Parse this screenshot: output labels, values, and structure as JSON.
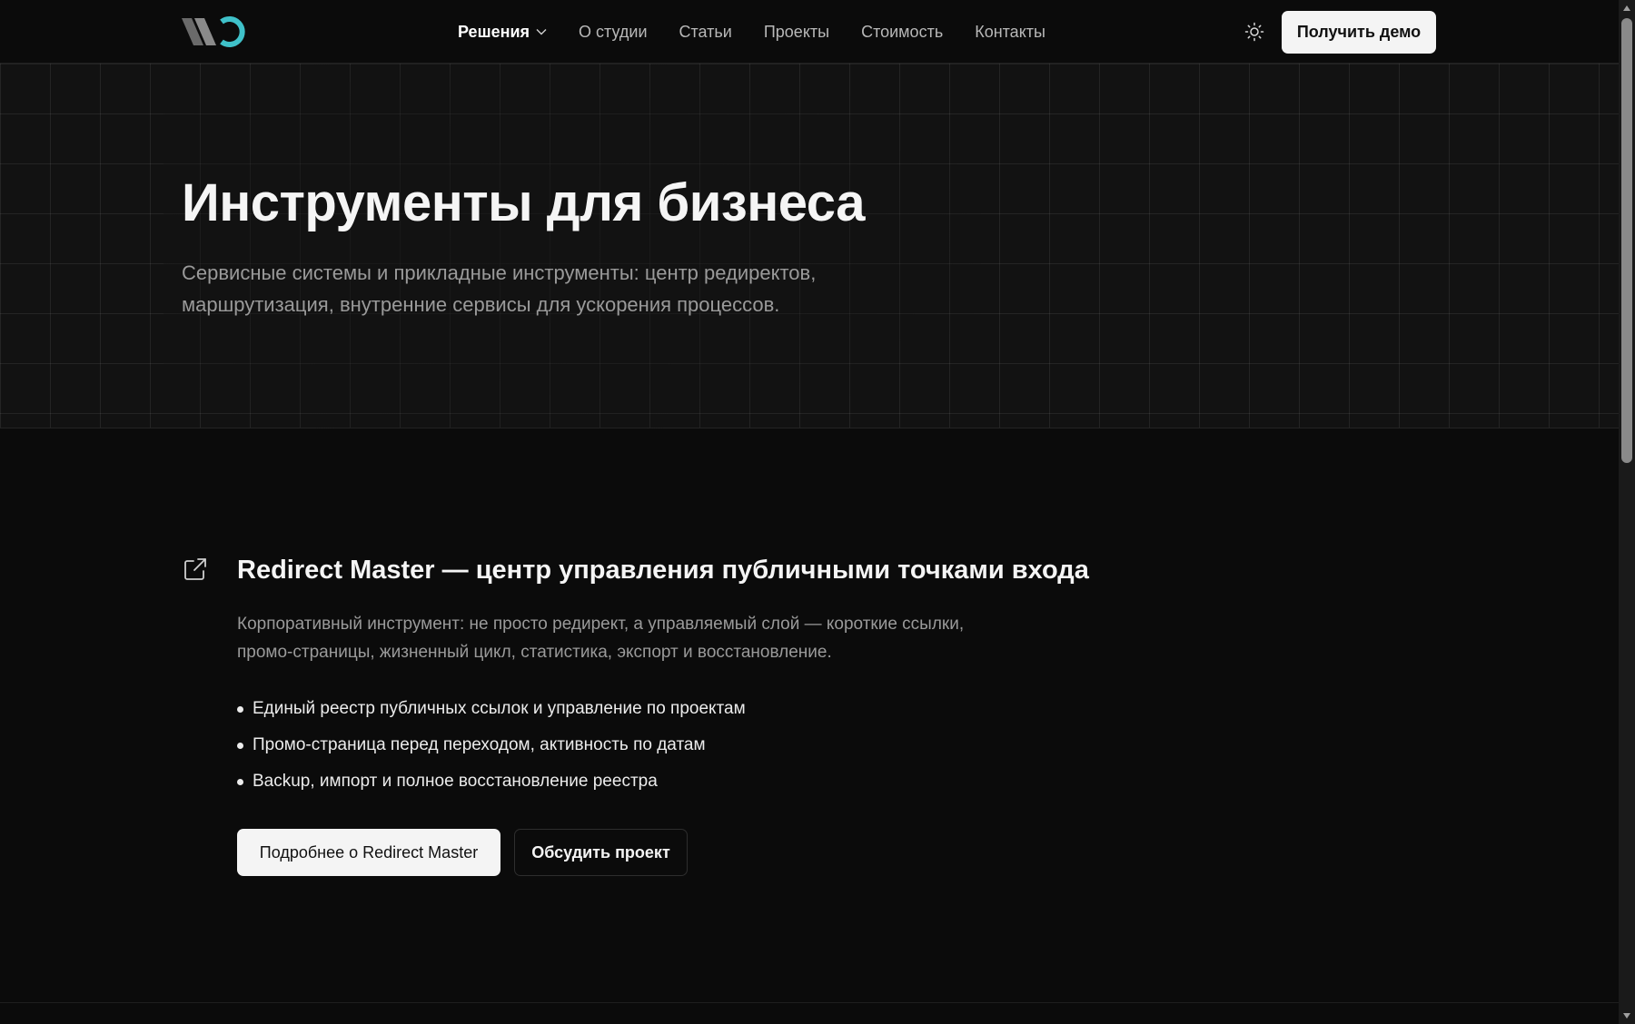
{
  "header": {
    "logo_icon": "studio-logo-icon",
    "nav": [
      {
        "label": "Решения",
        "active": true,
        "has_dropdown": true
      },
      {
        "label": "О студии",
        "active": false
      },
      {
        "label": "Статьи",
        "active": false
      },
      {
        "label": "Проекты",
        "active": false
      },
      {
        "label": "Стоимость",
        "active": false
      },
      {
        "label": "Контакты",
        "active": false
      }
    ],
    "theme_icon": "sun-icon",
    "cta_label": "Получить демо"
  },
  "hero": {
    "title": "Инструменты для бизнеса",
    "subtitle": "Сервисные системы и прикладные инструменты: центр редиректов, маршрутизация, внутренние сервисы для ускорения процессов."
  },
  "product": {
    "icon": "external-link-icon",
    "title": "Redirect Master — центр управления публичными точками входа",
    "description": "Корпоративный инструмент: не просто редирект, а управляемый слой — короткие ссылки, промо-страницы, жизненный цикл, статистика, экспорт и восстановление.",
    "features": [
      "Единый реестр публичных ссылок и управление по проектам",
      "Промо-страница перед переходом, активность по датам",
      "Backup, импорт и полное восстановление реестра"
    ],
    "primary_button": "Подробнее о Redirect Master",
    "secondary_button": "Обсудить проект"
  },
  "colors": {
    "background": "#0b0b0b",
    "hero_background": "#121212",
    "accent_logo": "#3fc1c9",
    "text_primary": "#f5f5f5",
    "text_muted": "#9a9a9a",
    "button_light": "#f4f4f4"
  }
}
